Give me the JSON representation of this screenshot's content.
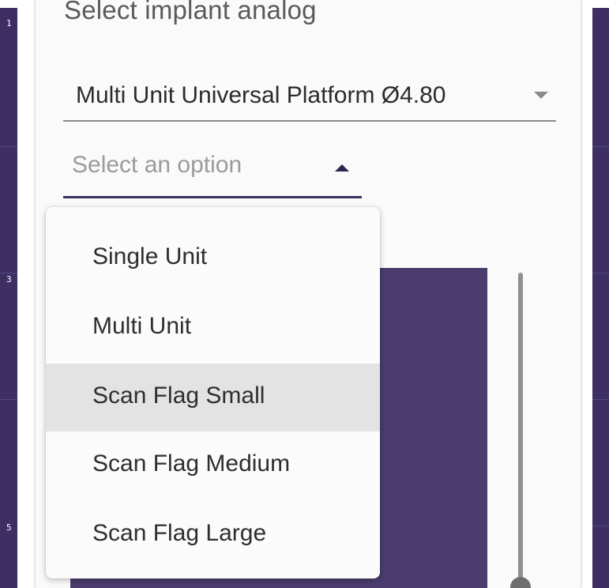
{
  "viewport": {
    "left_ticks": [
      "1",
      "3",
      "5"
    ]
  },
  "panel": {
    "title": "Select implant analog"
  },
  "analog_select": {
    "value": "Multi Unit Universal Platform Ø4.80",
    "arrow_icon": "caret-down-icon"
  },
  "option_select": {
    "placeholder": "Select an option",
    "state": "open",
    "arrow_icon": "caret-up-icon"
  },
  "dropdown": {
    "items": [
      {
        "label": "Single Unit"
      },
      {
        "label": "Multi Unit"
      },
      {
        "label": "Scan Flag Small"
      },
      {
        "label": "Scan Flag Medium"
      },
      {
        "label": "Scan Flag Large"
      }
    ],
    "highlighted_item": "Scan Flag Small"
  },
  "colors": {
    "viewport_bg": "#3d2f64",
    "accent": "#3f3361",
    "preview": "#4a3c6d",
    "highlight": "#e3e3e3"
  }
}
